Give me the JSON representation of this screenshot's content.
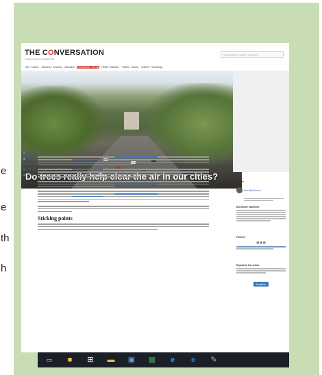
{
  "left_letters": [
    "e",
    "e",
    "th",
    "h"
  ],
  "site": {
    "logo_pre": "THE C",
    "logo_o": "O",
    "logo_post": "NVERSATION",
    "tagline": "Academic rigour, journalistic flair",
    "search_placeholder": "Search analysis, research, academics..."
  },
  "nav": {
    "items": [
      "Arts + Culture",
      "Business + Economy",
      "Education",
      "Environment + Energy",
      "Health + Medicine",
      "Politics + Society",
      "Science + Technology"
    ],
    "active_index": 3
  },
  "article": {
    "title": "Do trees really help clear the air in our cities?",
    "subheading": "Sticking points"
  },
  "share": {
    "items": [
      "Email",
      "Twitter",
      "Facebook",
      "LinkedIn",
      "Print"
    ]
  },
  "sidebar": {
    "author_heading": "Author",
    "author_name": "Rob MacKenzie",
    "disclosure_heading": "Disclosure statement",
    "partners_heading": "Partners",
    "republish_heading": "Republish this article",
    "republish_button": "Republish"
  },
  "taskbar": {
    "icons": [
      "task-view-icon",
      "file-explorer-icon",
      "store-icon",
      "folder-icon",
      "photos-icon",
      "excel-icon",
      "internet-explorer-icon",
      "edge-icon",
      "paint-icon"
    ]
  },
  "colors": {
    "accent": "#d8352a",
    "frame": "#c9ddb4",
    "link": "#3a78c2"
  }
}
